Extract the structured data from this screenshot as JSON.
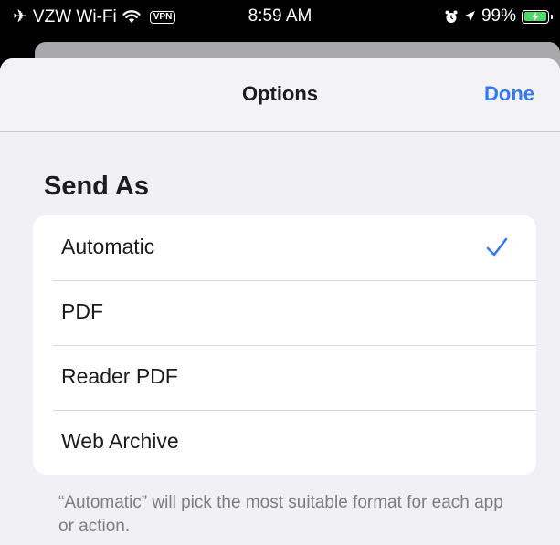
{
  "status_bar": {
    "carrier": "VZW Wi-Fi",
    "vpn": "VPN",
    "time": "8:59 AM",
    "battery_percent": "99%",
    "battery_level": 0.99
  },
  "nav": {
    "title": "Options",
    "done_label": "Done"
  },
  "section": {
    "header": "Send As"
  },
  "options": [
    {
      "label": "Automatic",
      "selected": true
    },
    {
      "label": "PDF",
      "selected": false
    },
    {
      "label": "Reader PDF",
      "selected": false
    },
    {
      "label": "Web Archive",
      "selected": false
    }
  ],
  "footer": {
    "note": "“Automatic” will pick the most suitable format for each app or action."
  },
  "colors": {
    "accent": "#3478f6",
    "battery": "#4cd964"
  }
}
